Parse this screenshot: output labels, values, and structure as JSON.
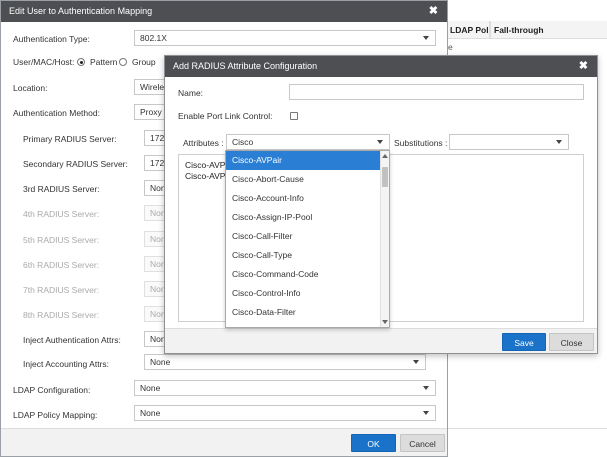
{
  "background": {
    "col1_header": "LDAP Polic...",
    "col2_header": "Fall-through",
    "row_fragment": "e"
  },
  "dialog1": {
    "title": "Edit User to Authentication Mapping",
    "fields": {
      "auth_type": {
        "label": "Authentication Type:",
        "value": "802.1X"
      },
      "user_mac_host": {
        "label": "User/MAC/Host:",
        "option_pattern": "Pattern",
        "option_group": "Group",
        "selected": "Pattern"
      },
      "location": {
        "label": "Location:",
        "value": "Wirele"
      },
      "auth_method": {
        "label": "Authentication Method:",
        "value": "Proxy"
      },
      "primary_radius": {
        "label": "Primary RADIUS Server:",
        "value": "172."
      },
      "secondary_radius": {
        "label": "Secondary RADIUS Server:",
        "value": "172."
      },
      "radius3": {
        "label": "3rd RADIUS Server:",
        "value": "None"
      },
      "radius4": {
        "label": "4th RADIUS Server:",
        "value": "Non"
      },
      "radius5": {
        "label": "5th RADIUS Server:",
        "value": "Non"
      },
      "radius6": {
        "label": "6th RADIUS Server:",
        "value": "Non"
      },
      "radius7": {
        "label": "7th RADIUS Server:",
        "value": "Non"
      },
      "radius8": {
        "label": "8th RADIUS Server:",
        "value": "Non"
      },
      "inject_auth": {
        "label": "Inject Authentication Attrs:",
        "value": "Non"
      },
      "inject_acct": {
        "label": "Inject Accounting Attrs:",
        "value": "None"
      },
      "ldap_config": {
        "label": "LDAP Configuration:",
        "value": "None"
      },
      "ldap_policy": {
        "label": "LDAP Policy Mapping:",
        "value": "None"
      }
    },
    "ok_label": "OK",
    "cancel_label": "Cancel"
  },
  "dialog2": {
    "title": "Add RADIUS Attribute Configuration",
    "name_label": "Name:",
    "name_value": "",
    "port_link_label": "Enable Port Link Control:",
    "attributes_label": "Attributes :",
    "attributes_value": "Cisco",
    "substitutions_label": "Substitutions :",
    "substitutions_value": "",
    "attr_lines": [
      "Cisco-AVPa",
      "Cisco-AVPa"
    ],
    "save_label": "Save",
    "close_label": "Close"
  },
  "dropdown": {
    "items": [
      "Cisco-AVPair",
      "Cisco-Abort-Cause",
      "Cisco-Account-Info",
      "Cisco-Assign-IP-Pool",
      "Cisco-Call-Filter",
      "Cisco-Call-Type",
      "Cisco-Command-Code",
      "Cisco-Control-Info",
      "Cisco-Data-Filter"
    ],
    "highlighted_index": 0
  },
  "colors": {
    "titlebar": "#4d4f53",
    "primary_button": "#1a73c8",
    "highlight": "#2a7fd4"
  }
}
